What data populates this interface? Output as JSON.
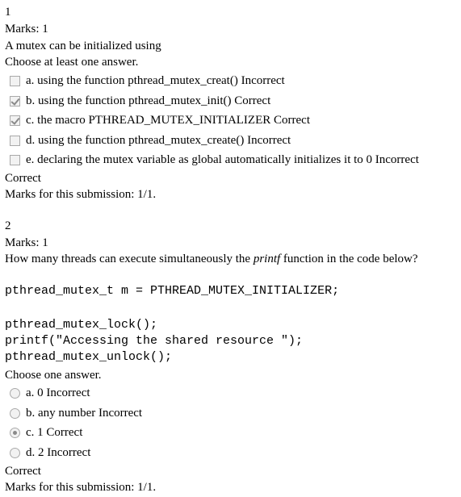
{
  "q1": {
    "number": "1",
    "marks": "Marks: 1",
    "question": "A mutex can be initialized using",
    "instruction": "Choose at least one answer.",
    "options": [
      {
        "text": "a. using the function pthread_mutex_creat() Incorrect",
        "checked": false
      },
      {
        "text": "b. using the function pthread_mutex_init() Correct",
        "checked": true
      },
      {
        "text": "c. the macro PTHREAD_MUTEX_INITIALIZER Correct",
        "checked": true
      },
      {
        "text": "d. using the function pthread_mutex_create() Incorrect",
        "checked": false
      },
      {
        "text": "e. declaring the mutex variable as global automatically initializes it to 0 Incorrect",
        "checked": false
      }
    ],
    "result": "Correct",
    "submission": "Marks for this submission: 1/1."
  },
  "q2": {
    "number": "2",
    "marks": "Marks: 1",
    "question_pre": "How many threads can execute simultaneously the ",
    "question_em": "printf",
    "question_post": " function in the code below?",
    "code": [
      "pthread_mutex_t m = PTHREAD_MUTEX_INITIALIZER;",
      "pthread_mutex_lock();",
      "printf(\"Accessing the shared resource \");",
      "pthread_mutex_unlock();"
    ],
    "instruction": "Choose one answer.",
    "options": [
      {
        "text": "a. 0 Incorrect",
        "checked": false
      },
      {
        "text": "b. any number Incorrect",
        "checked": false
      },
      {
        "text": "c. 1 Correct",
        "checked": true
      },
      {
        "text": "d. 2 Incorrect",
        "checked": false
      }
    ],
    "result": "Correct",
    "submission": "Marks for this submission: 1/1."
  }
}
